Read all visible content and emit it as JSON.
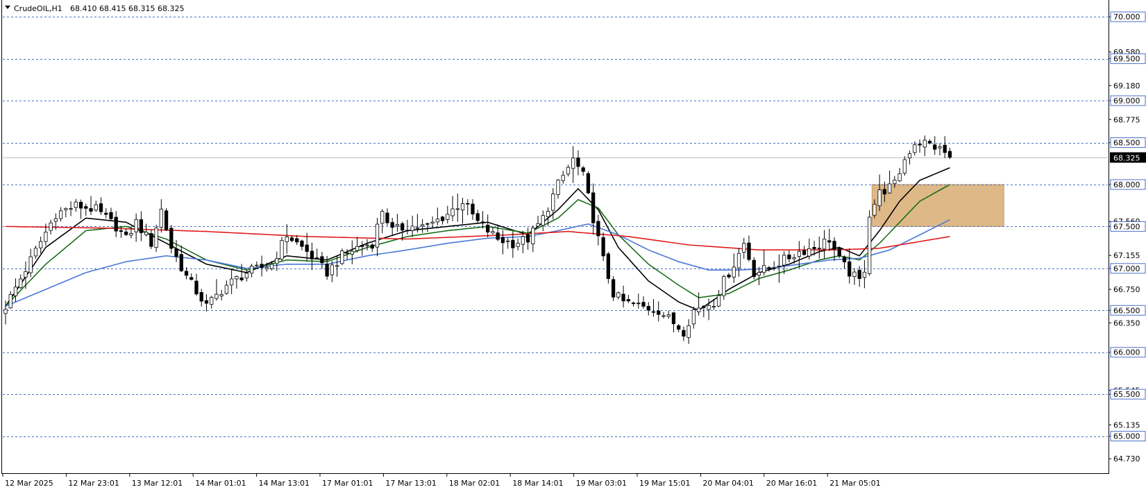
{
  "header": {
    "symbol": "CrudeOIL,H1",
    "ohlc": "68.410 68.415 68.315 68.325",
    "menu_icon": "triangle-down-icon"
  },
  "colors": {
    "background": "#ffffff",
    "grid_line": "#4a6fc7",
    "current_price_line": "#c0c0c0",
    "bull_candle": "#ffffff",
    "bear_candle": "#000000",
    "ma_black": "#000000",
    "ma_green": "#1a6e1a",
    "ma_blue": "#4a78d8",
    "ma_red": "#e01b1b",
    "zone": "#deb887",
    "price_tag_bg": "#000000",
    "price_tag_text": "#ffffff"
  },
  "chart_data": {
    "type": "candlestick",
    "title": "CrudeOIL,H1",
    "ylim": [
      64.55,
      70.2
    ],
    "grid": "horizontal dashed at levels",
    "level_lines": [
      70.0,
      69.5,
      69.0,
      68.5,
      68.0,
      67.5,
      67.0,
      66.5,
      66.0,
      65.5,
      65.0
    ],
    "y_axis_labels": [
      "70.000",
      "69.580",
      "69.500",
      "69.180",
      "69.000",
      "68.775",
      "68.500",
      "68.000",
      "67.560",
      "67.500",
      "67.155",
      "67.000",
      "66.750",
      "66.500",
      "66.350",
      "66.000",
      "65.545",
      "65.500",
      "65.135",
      "65.000",
      "64.730"
    ],
    "x_labels": [
      "12 Mar 2025",
      "12 Mar 23:01",
      "13 Mar 12:01",
      "14 Mar 01:01",
      "14 Mar 13:01",
      "17 Mar 01:01",
      "17 Mar 13:01",
      "18 Mar 02:01",
      "18 Mar 14:01",
      "19 Mar 03:01",
      "19 Mar 15:01",
      "20 Mar 04:01",
      "20 Mar 16:01",
      "21 Mar 05:01"
    ],
    "current_price": 68.325,
    "current_price_label": "68.325",
    "zone": {
      "y_low": 67.5,
      "y_high": 68.0,
      "x_start": "20 Mar 16:01",
      "x_end": "21 Mar 09:01"
    },
    "anchors": [
      {
        "i": 0,
        "p": 66.55
      },
      {
        "i": 5,
        "p": 67.1
      },
      {
        "i": 10,
        "p": 67.65
      },
      {
        "i": 14,
        "p": 67.75
      },
      {
        "i": 18,
        "p": 67.7
      },
      {
        "i": 22,
        "p": 67.5
      },
      {
        "i": 24,
        "p": 67.35
      },
      {
        "i": 26,
        "p": 67.55
      },
      {
        "i": 29,
        "p": 67.3
      },
      {
        "i": 31,
        "p": 67.7
      },
      {
        "i": 33,
        "p": 67.25
      },
      {
        "i": 36,
        "p": 66.9
      },
      {
        "i": 40,
        "p": 66.55
      },
      {
        "i": 44,
        "p": 66.8
      },
      {
        "i": 48,
        "p": 66.95
      },
      {
        "i": 53,
        "p": 67.05
      },
      {
        "i": 56,
        "p": 67.4
      },
      {
        "i": 60,
        "p": 67.2
      },
      {
        "i": 64,
        "p": 66.95
      },
      {
        "i": 67,
        "p": 67.15
      },
      {
        "i": 70,
        "p": 67.25
      },
      {
        "i": 73,
        "p": 67.3
      },
      {
        "i": 75,
        "p": 67.7
      },
      {
        "i": 77,
        "p": 67.45
      },
      {
        "i": 80,
        "p": 67.5
      },
      {
        "i": 84,
        "p": 67.5
      },
      {
        "i": 88,
        "p": 67.65
      },
      {
        "i": 91,
        "p": 67.8
      },
      {
        "i": 94,
        "p": 67.55
      },
      {
        "i": 98,
        "p": 67.35
      },
      {
        "i": 101,
        "p": 67.3
      },
      {
        "i": 104,
        "p": 67.35
      },
      {
        "i": 107,
        "p": 67.6
      },
      {
        "i": 110,
        "p": 68.0
      },
      {
        "i": 113,
        "p": 68.3
      },
      {
        "i": 115,
        "p": 68.1
      },
      {
        "i": 117,
        "p": 67.6
      },
      {
        "i": 119,
        "p": 67.1
      },
      {
        "i": 121,
        "p": 66.7
      },
      {
        "i": 123,
        "p": 66.6
      },
      {
        "i": 126,
        "p": 66.55
      },
      {
        "i": 130,
        "p": 66.5
      },
      {
        "i": 133,
        "p": 66.35
      },
      {
        "i": 135,
        "p": 66.25
      },
      {
        "i": 137,
        "p": 66.5
      },
      {
        "i": 141,
        "p": 66.6
      },
      {
        "i": 143,
        "p": 66.85
      },
      {
        "i": 145,
        "p": 67.05
      },
      {
        "i": 147,
        "p": 67.3
      },
      {
        "i": 149,
        "p": 66.95
      },
      {
        "i": 152,
        "p": 67.0
      },
      {
        "i": 155,
        "p": 67.1
      },
      {
        "i": 158,
        "p": 67.2
      },
      {
        "i": 161,
        "p": 67.25
      },
      {
        "i": 164,
        "p": 67.35
      },
      {
        "i": 166,
        "p": 67.1
      },
      {
        "i": 168,
        "p": 66.95
      },
      {
        "i": 170,
        "p": 66.85
      },
      {
        "i": 171,
        "p": 67.0
      },
      {
        "i": 172,
        "p": 67.65
      },
      {
        "i": 174,
        "p": 67.9
      },
      {
        "i": 177,
        "p": 68.0
      },
      {
        "i": 179,
        "p": 68.3
      },
      {
        "i": 181,
        "p": 68.5
      },
      {
        "i": 183,
        "p": 68.5
      },
      {
        "i": 185,
        "p": 68.45
      },
      {
        "i": 187,
        "p": 68.38
      },
      {
        "i": 188,
        "p": 68.325
      }
    ],
    "series": [
      {
        "name": "",
        "kind": "moving-average",
        "color": "#000000",
        "values_ref": "close",
        "points": [
          {
            "i": 0,
            "p": 66.55
          },
          {
            "i": 8,
            "p": 67.25
          },
          {
            "i": 16,
            "p": 67.6
          },
          {
            "i": 24,
            "p": 67.55
          },
          {
            "i": 32,
            "p": 67.3
          },
          {
            "i": 40,
            "p": 67.05
          },
          {
            "i": 48,
            "p": 66.95
          },
          {
            "i": 56,
            "p": 67.15
          },
          {
            "i": 64,
            "p": 67.1
          },
          {
            "i": 72,
            "p": 67.3
          },
          {
            "i": 80,
            "p": 67.45
          },
          {
            "i": 88,
            "p": 67.5
          },
          {
            "i": 96,
            "p": 67.55
          },
          {
            "i": 104,
            "p": 67.4
          },
          {
            "i": 110,
            "p": 67.7
          },
          {
            "i": 114,
            "p": 67.95
          },
          {
            "i": 118,
            "p": 67.7
          },
          {
            "i": 122,
            "p": 67.25
          },
          {
            "i": 128,
            "p": 66.85
          },
          {
            "i": 134,
            "p": 66.6
          },
          {
            "i": 138,
            "p": 66.5
          },
          {
            "i": 144,
            "p": 66.75
          },
          {
            "i": 150,
            "p": 66.95
          },
          {
            "i": 156,
            "p": 67.05
          },
          {
            "i": 162,
            "p": 67.2
          },
          {
            "i": 166,
            "p": 67.25
          },
          {
            "i": 170,
            "p": 67.15
          },
          {
            "i": 174,
            "p": 67.45
          },
          {
            "i": 178,
            "p": 67.8
          },
          {
            "i": 182,
            "p": 68.05
          },
          {
            "i": 188,
            "p": 68.2
          }
        ]
      },
      {
        "name": "",
        "kind": "moving-average",
        "color": "#1a6e1a",
        "points": [
          {
            "i": 0,
            "p": 66.55
          },
          {
            "i": 8,
            "p": 67.05
          },
          {
            "i": 16,
            "p": 67.45
          },
          {
            "i": 24,
            "p": 67.5
          },
          {
            "i": 32,
            "p": 67.35
          },
          {
            "i": 40,
            "p": 67.1
          },
          {
            "i": 48,
            "p": 66.98
          },
          {
            "i": 56,
            "p": 67.1
          },
          {
            "i": 64,
            "p": 67.08
          },
          {
            "i": 72,
            "p": 67.25
          },
          {
            "i": 80,
            "p": 67.38
          },
          {
            "i": 88,
            "p": 67.45
          },
          {
            "i": 96,
            "p": 67.5
          },
          {
            "i": 104,
            "p": 67.42
          },
          {
            "i": 110,
            "p": 67.6
          },
          {
            "i": 114,
            "p": 67.82
          },
          {
            "i": 118,
            "p": 67.72
          },
          {
            "i": 122,
            "p": 67.4
          },
          {
            "i": 128,
            "p": 67.05
          },
          {
            "i": 134,
            "p": 66.8
          },
          {
            "i": 138,
            "p": 66.65
          },
          {
            "i": 144,
            "p": 66.7
          },
          {
            "i": 150,
            "p": 66.88
          },
          {
            "i": 156,
            "p": 66.98
          },
          {
            "i": 162,
            "p": 67.1
          },
          {
            "i": 166,
            "p": 67.15
          },
          {
            "i": 170,
            "p": 67.1
          },
          {
            "i": 174,
            "p": 67.3
          },
          {
            "i": 178,
            "p": 67.55
          },
          {
            "i": 182,
            "p": 67.8
          },
          {
            "i": 188,
            "p": 68.0
          }
        ]
      },
      {
        "name": "",
        "kind": "moving-average",
        "color": "#4a78d8",
        "points": [
          {
            "i": 0,
            "p": 66.55
          },
          {
            "i": 8,
            "p": 66.75
          },
          {
            "i": 16,
            "p": 66.95
          },
          {
            "i": 24,
            "p": 67.08
          },
          {
            "i": 32,
            "p": 67.15
          },
          {
            "i": 40,
            "p": 67.1
          },
          {
            "i": 48,
            "p": 67.0
          },
          {
            "i": 56,
            "p": 67.05
          },
          {
            "i": 64,
            "p": 67.05
          },
          {
            "i": 72,
            "p": 67.15
          },
          {
            "i": 80,
            "p": 67.22
          },
          {
            "i": 88,
            "p": 67.3
          },
          {
            "i": 96,
            "p": 67.36
          },
          {
            "i": 104,
            "p": 67.38
          },
          {
            "i": 110,
            "p": 67.45
          },
          {
            "i": 116,
            "p": 67.53
          },
          {
            "i": 122,
            "p": 67.4
          },
          {
            "i": 128,
            "p": 67.22
          },
          {
            "i": 134,
            "p": 67.08
          },
          {
            "i": 140,
            "p": 66.98
          },
          {
            "i": 146,
            "p": 66.98
          },
          {
            "i": 152,
            "p": 67.0
          },
          {
            "i": 158,
            "p": 67.05
          },
          {
            "i": 164,
            "p": 67.1
          },
          {
            "i": 170,
            "p": 67.12
          },
          {
            "i": 176,
            "p": 67.22
          },
          {
            "i": 182,
            "p": 67.4
          },
          {
            "i": 188,
            "p": 67.58
          }
        ]
      },
      {
        "name": "",
        "kind": "moving-average",
        "color": "#e01b1b",
        "points": [
          {
            "i": 0,
            "p": 67.5
          },
          {
            "i": 20,
            "p": 67.48
          },
          {
            "i": 40,
            "p": 67.44
          },
          {
            "i": 60,
            "p": 67.38
          },
          {
            "i": 80,
            "p": 67.35
          },
          {
            "i": 100,
            "p": 67.4
          },
          {
            "i": 112,
            "p": 67.44
          },
          {
            "i": 124,
            "p": 67.38
          },
          {
            "i": 136,
            "p": 67.28
          },
          {
            "i": 150,
            "p": 67.22
          },
          {
            "i": 165,
            "p": 67.22
          },
          {
            "i": 174,
            "p": 67.24
          },
          {
            "i": 182,
            "p": 67.32
          },
          {
            "i": 188,
            "p": 67.38
          }
        ]
      }
    ]
  }
}
